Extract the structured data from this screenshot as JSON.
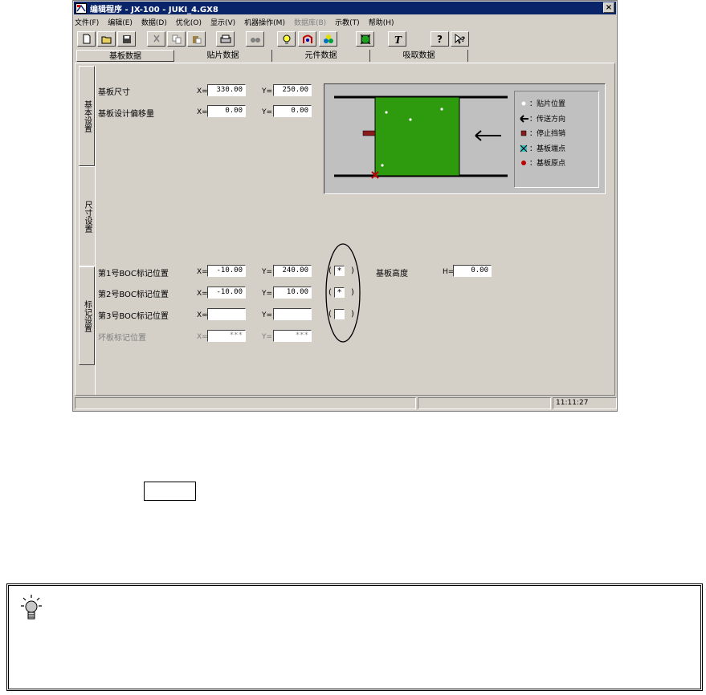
{
  "window": {
    "title": "编辑程序 - JX-100 - JUKI_4.GX8",
    "close_label": "×"
  },
  "menu": [
    {
      "label": "文件(F)",
      "disabled": false
    },
    {
      "label": "编辑(E)",
      "disabled": false
    },
    {
      "label": "数据(D)",
      "disabled": false
    },
    {
      "label": "优化(O)",
      "disabled": false
    },
    {
      "label": "显示(V)",
      "disabled": false
    },
    {
      "label": "机器操作(M)",
      "disabled": false
    },
    {
      "label": "数据库(B)",
      "disabled": true
    },
    {
      "label": "示教(T)",
      "disabled": false
    },
    {
      "label": "帮助(H)",
      "disabled": false
    }
  ],
  "toolbar": {
    "icons": [
      "new-file-icon",
      "open-folder-icon",
      "save-icon",
      "cut-icon",
      "copy-icon",
      "paste-icon",
      "print-icon",
      "find-icon",
      "lightbulb-icon",
      "component-icon",
      "link-icon",
      "board-icon",
      "text-icon",
      "help-icon",
      "context-help-icon"
    ]
  },
  "tabs": [
    "基板数据",
    "贴片数据",
    "元件数据",
    "吸取数据"
  ],
  "side_tabs": [
    "基本设置",
    "尺寸设置",
    "标记设置"
  ],
  "board_size": {
    "label": "基板尺寸",
    "x_label": "X=",
    "y_label": "Y=",
    "x": "330.00",
    "y": "250.00"
  },
  "design_offset": {
    "label": "基板设计偏移量",
    "x_label": "X=",
    "y_label": "Y=",
    "x": "0.00",
    "y": "0.00"
  },
  "boc_marks": [
    {
      "label": "第1号BOC标记位置",
      "x_label": "X=",
      "y_label": "Y=",
      "x": "-10.00",
      "y": "240.00",
      "check": "*"
    },
    {
      "label": "第2号BOC标记位置",
      "x_label": "X=",
      "y_label": "Y=",
      "x": "-10.00",
      "y": "10.00",
      "check": "*"
    },
    {
      "label": "第3号BOC标记位置",
      "x_label": "X=",
      "y_label": "Y=",
      "x": "",
      "y": "",
      "check": ""
    }
  ],
  "bad_mark": {
    "label": "坏板标记位置",
    "x_label": "X=",
    "y_label": "Y=",
    "x": "***",
    "y": "***"
  },
  "board_height": {
    "label": "基板高度",
    "h_label": "H=",
    "value": "0.00"
  },
  "legend": [
    {
      "icon": "placement-dot-icon",
      "label": "：贴片位置"
    },
    {
      "icon": "arrow-left-icon",
      "label": "：传送方向"
    },
    {
      "icon": "stopper-icon",
      "label": "：停止挡销"
    },
    {
      "icon": "board-end-icon",
      "label": "：基板端点"
    },
    {
      "icon": "board-origin-icon",
      "label": "：基板原点"
    }
  ],
  "status": {
    "time": "11:11:27"
  },
  "colors": {
    "title": "#0a246a",
    "board": "#2e9a0e",
    "stopper": "#8b1a1a",
    "face": "#d4d0c8"
  }
}
